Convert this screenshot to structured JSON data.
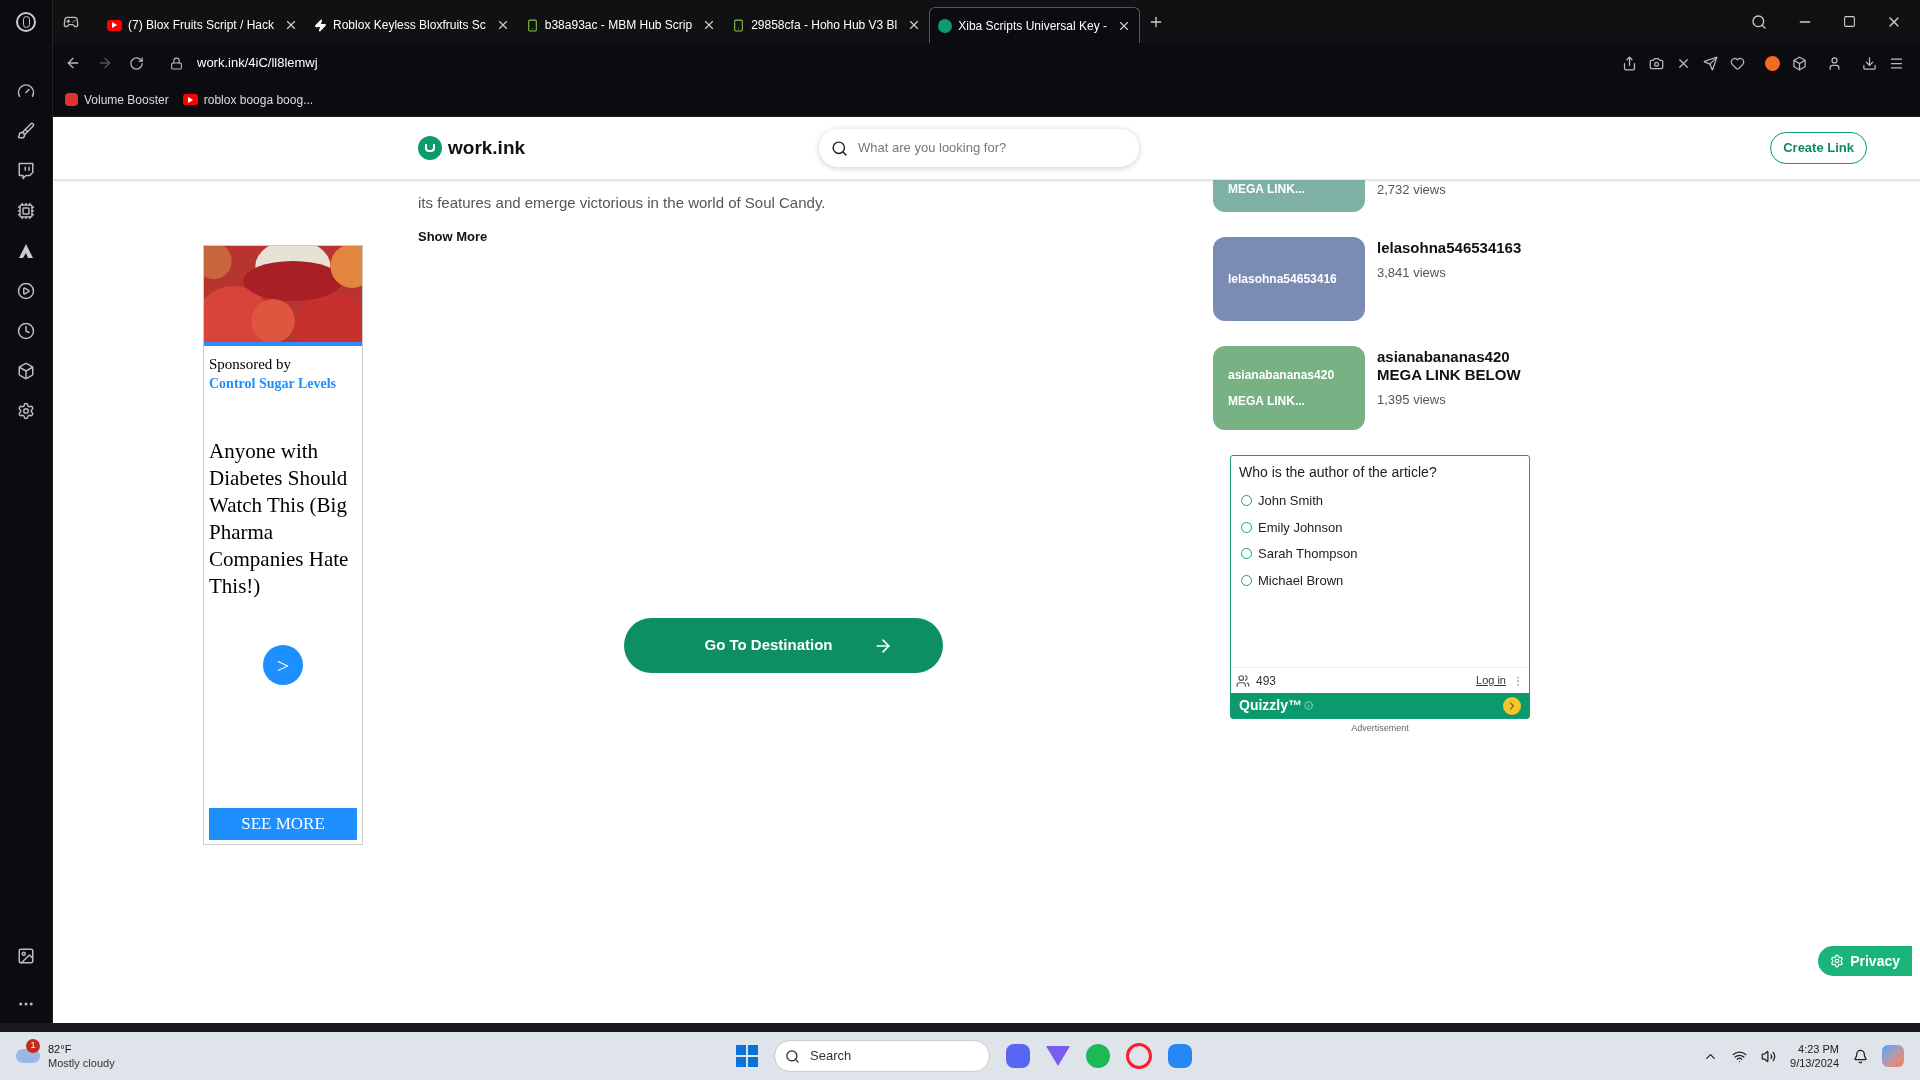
{
  "browser": {
    "tabs": [
      {
        "label": "(7) Blox Fruits Script / Hack",
        "kind": "youtube",
        "selected": false
      },
      {
        "label": "Roblox Keyless Bloxfruits Sc",
        "kind": "bolt",
        "selected": false
      },
      {
        "label": "b38a93ac - MBM Hub Scrip",
        "kind": "android",
        "selected": false
      },
      {
        "label": "29858cfa - Hoho Hub V3 Bl",
        "kind": "android",
        "selected": false
      },
      {
        "label": "Xiba Scripts Universal Key -",
        "kind": "worklogo",
        "selected": true
      }
    ],
    "address": "work.ink/4iC/ll8lemwj",
    "bookmarks": [
      {
        "label": "Volume Booster",
        "kind": "ext"
      },
      {
        "label": "roblox booga boog...",
        "kind": "youtube"
      }
    ]
  },
  "site": {
    "logo": "work.ink",
    "search_placeholder": "What are you looking for?",
    "create_link": "Create Link"
  },
  "article": {
    "text": "its features and emerge victorious in the world of Soul Candy.",
    "show_more": "Show More",
    "cta": "Go To Destination"
  },
  "ad": {
    "sponsor_prefix": "Sponsored by",
    "sponsor": "Control Sugar Levels",
    "headline": "Anyone with Diabetes Should Watch This (Big Pharma Companies Hate This!)",
    "arrow": ">",
    "button": "SEE MORE"
  },
  "related": [
    {
      "thumb": [
        "MEGA LINK..."
      ],
      "views": "2,732 views",
      "color": "#7fb0a6"
    },
    {
      "thumb": [
        "lelasohna54653416"
      ],
      "title": [
        "lelasohna546534163"
      ],
      "views": "3,841 views",
      "color": "#7b8cb4"
    },
    {
      "thumb": [
        "asianabananas420",
        "MEGA LINK..."
      ],
      "title": [
        "asianabananas420",
        "MEGA LINK BELOW"
      ],
      "views": "1,395 views",
      "color": "#78b183"
    }
  ],
  "quiz": {
    "question": "Who is the author of the article?",
    "options": [
      {
        "label": "John Smith",
        "selected": false
      },
      {
        "label": "Emily Johnson",
        "selected": false
      },
      {
        "label": "Sarah Thompson",
        "selected": false
      },
      {
        "label": "Michael Brown",
        "selected": false
      }
    ],
    "count": "493",
    "login": "Log in",
    "brand": "Quizzly™",
    "note": "Advertisement"
  },
  "privacy": "Privacy",
  "taskbar": {
    "weather_badge": "1",
    "temp": "82°F",
    "weather": "Mostly cloudy",
    "search": "Search",
    "time": "4:23 PM",
    "date": "9/13/2024"
  }
}
